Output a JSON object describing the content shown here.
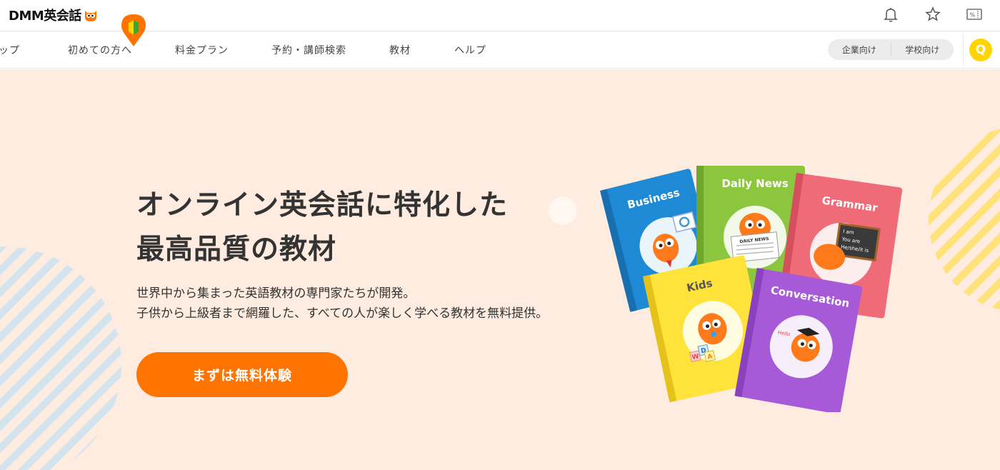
{
  "header": {
    "logo_text": "DMM英会話",
    "icons": [
      "bell-icon",
      "star-icon",
      "coupon-icon"
    ]
  },
  "nav": {
    "items": [
      {
        "label": "ップ"
      },
      {
        "label": "初めての方へ"
      },
      {
        "label": "料金プラン"
      },
      {
        "label": "予約・講師検索"
      },
      {
        "label": "教材"
      },
      {
        "label": "ヘルプ"
      }
    ],
    "business_label": "企業向け",
    "school_label": "学校向け",
    "q_label": "Q"
  },
  "hero": {
    "title_line1": "オンライン英会話に特化した",
    "title_line2": "最高品質の教材",
    "desc_line1": "世界中から集まった英語教材の専門家たちが開発。",
    "desc_line2": "子供から上級者まで網羅した、すべての人が楽しく学べる教材を無料提供。",
    "cta_label": "まずは無料体験"
  },
  "books": {
    "business": "Business",
    "daily_news": "Daily News",
    "grammar": "Grammar",
    "kids": "Kids",
    "conversation": "Conversation",
    "daily_news_paper": "DAILY NEWS",
    "grammar_board_1": "I am",
    "grammar_board_2": "You are",
    "grammar_board_3": "He/she/it is",
    "conversation_hello": "Hello",
    "kids_block_w": "W",
    "kids_block_d": "D",
    "kids_block_a": "A"
  },
  "colors": {
    "brand_orange": "#ff7300",
    "hero_bg": "#fdecdf",
    "q_yellow": "#ffd400",
    "book_business": "#1e8ad6",
    "book_daily_news": "#8cc63f",
    "book_grammar": "#f06b78",
    "book_kids": "#ffe23a",
    "book_conversation": "#a65ad8"
  }
}
